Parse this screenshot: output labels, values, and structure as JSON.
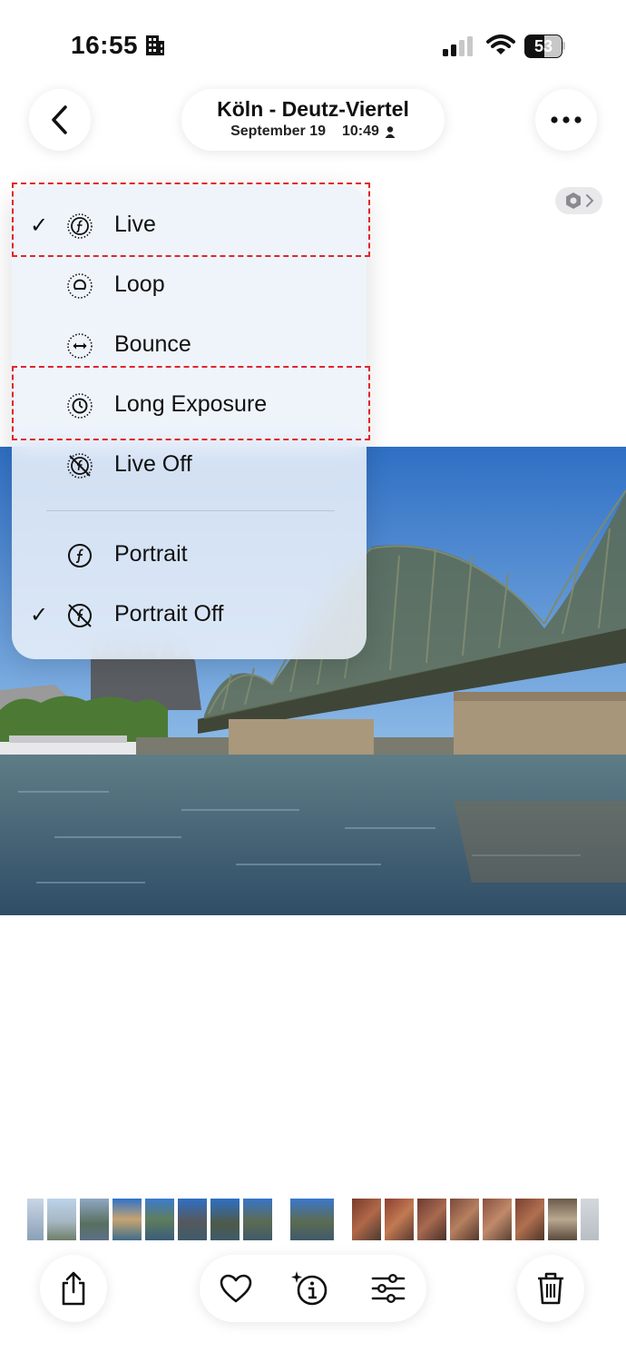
{
  "status": {
    "time": "16:55",
    "battery": "53",
    "battery_level": 0.53
  },
  "header": {
    "title": "Köln - Deutz-Viertel",
    "date": "September 19",
    "time": "10:49"
  },
  "menu": {
    "items": [
      {
        "label": "Live",
        "icon": "live-photo-icon",
        "checked": true
      },
      {
        "label": "Loop",
        "icon": "loop-icon",
        "checked": false
      },
      {
        "label": "Bounce",
        "icon": "bounce-icon",
        "checked": false
      },
      {
        "label": "Long Exposure",
        "icon": "long-exposure-icon",
        "checked": false
      },
      {
        "label": "Live Off",
        "icon": "live-off-icon",
        "checked": false
      },
      {
        "label": "Portrait",
        "icon": "portrait-icon",
        "checked": false
      },
      {
        "label": "Portrait Off",
        "icon": "portrait-off-icon",
        "checked": true
      }
    ],
    "check_glyph": "✓"
  },
  "toolbar": {
    "icons": [
      "share-icon",
      "heart-icon",
      "info-sparkle-icon",
      "adjust-icon",
      "trash-icon"
    ]
  },
  "colors": {
    "highlight": "#e0262b",
    "sky": "#4a86cf",
    "bridge": "#5d6b52",
    "water": "#3f5a6a"
  }
}
